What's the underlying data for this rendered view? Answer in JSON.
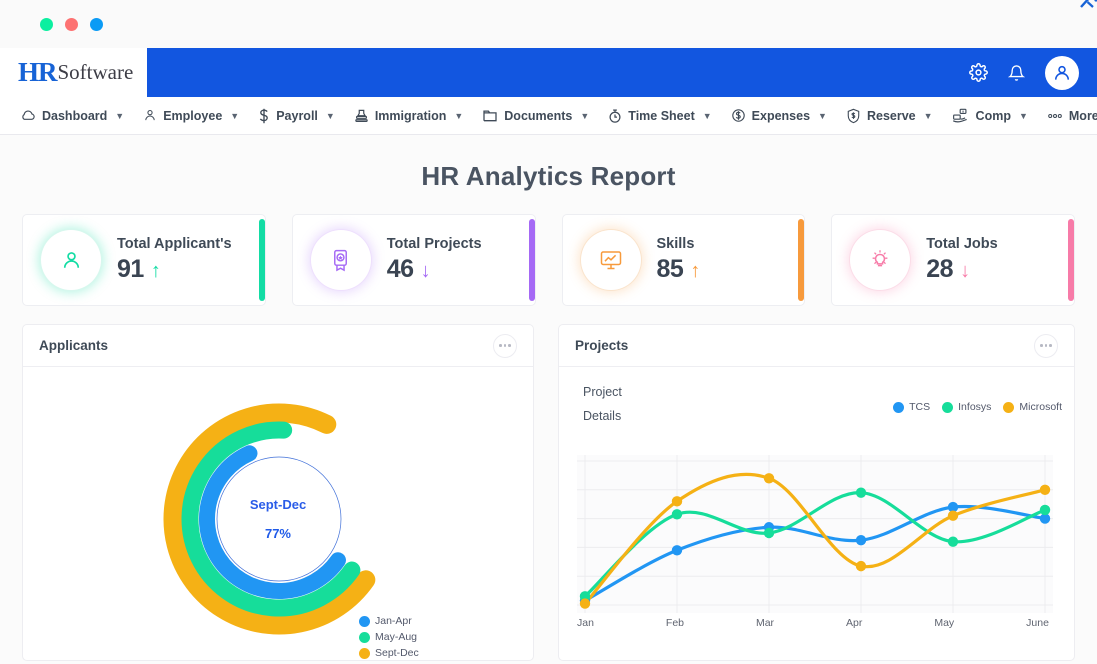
{
  "window": {
    "dots": [
      "green",
      "red",
      "blue"
    ]
  },
  "brand": {
    "hr": "HR",
    "software": "Software"
  },
  "header": {
    "icons": [
      "gear-icon",
      "bell-icon",
      "avatar"
    ]
  },
  "nav": {
    "items": [
      {
        "label": "Dashboard",
        "icon": "cloud-icon",
        "caret": true
      },
      {
        "label": "Employee",
        "icon": "user-icon",
        "caret": true
      },
      {
        "label": "Payroll",
        "icon": "dollar-icon",
        "caret": true
      },
      {
        "label": "Immigration",
        "icon": "stamp-icon",
        "caret": true
      },
      {
        "label": "Documents",
        "icon": "folder-icon",
        "caret": true
      },
      {
        "label": "Time Sheet",
        "icon": "clock-icon",
        "caret": true
      },
      {
        "label": "Expenses",
        "icon": "dollar-circle-icon",
        "caret": true
      },
      {
        "label": "Reserve",
        "icon": "shield-dollar-icon",
        "caret": true
      },
      {
        "label": "Comp",
        "icon": "cash-hand-icon",
        "caret": true
      },
      {
        "label": "More",
        "icon": "ellipsis-icon",
        "caret": false
      }
    ]
  },
  "page": {
    "title": "HR Analytics Report"
  },
  "stats": [
    {
      "label": "Total Applicant's",
      "value": "91",
      "trend": "up",
      "arrow": "↑",
      "color": "#13dca4",
      "icon": "person-icon"
    },
    {
      "label": "Total Projects",
      "value": "46",
      "trend": "down",
      "arrow": "↓",
      "color": "#a569f5",
      "icon": "award-badge-icon"
    },
    {
      "label": "Skills",
      "value": "85",
      "trend": "up",
      "arrow": "↑",
      "color": "#f79a3c",
      "icon": "monitor-chart-icon"
    },
    {
      "label": "Total Jobs",
      "value": "28",
      "trend": "down",
      "arrow": "↓",
      "color": "#f77ba8",
      "icon": "lightbulb-icon"
    }
  ],
  "applicants_panel": {
    "title": "Applicants",
    "menu_icon": "kebab-menu-icon"
  },
  "projects_panel": {
    "title": "Projects",
    "menu_icon": "kebab-menu-icon",
    "heading_line1": "Project",
    "heading_line2": "Details"
  },
  "chart_data": [
    {
      "type": "pie",
      "variant": "radial-multi-ring-gauge",
      "title": "Applicants",
      "center_label": "Sept-Dec",
      "center_value": "77%",
      "legend_position": "bottom-right",
      "categories": [
        "Jan-Apr",
        "May-Aug",
        "Sept-Dec"
      ],
      "values": [
        62,
        70,
        77
      ],
      "colors": [
        "#2196f3",
        "#16dd9a",
        "#f5b115"
      ],
      "series": [
        {
          "name": "Jan-Apr",
          "value": 62,
          "ring": "inner",
          "color": "#2196f3"
        },
        {
          "name": "May-Aug",
          "value": 70,
          "ring": "middle",
          "color": "#16dd9a"
        },
        {
          "name": "Sept-Dec",
          "value": 77,
          "ring": "outer",
          "color": "#f5b115"
        }
      ]
    },
    {
      "type": "line",
      "title": "Project Details",
      "xlabel": "",
      "ylabel": "",
      "grid": true,
      "legend_position": "top-right",
      "categories": [
        "Jan",
        "Feb",
        "Mar",
        "Apr",
        "May",
        "June"
      ],
      "ylim": [
        0,
        100
      ],
      "series": [
        {
          "name": "TCS",
          "color": "#2196f3",
          "values": [
            3,
            38,
            54,
            45,
            68,
            60
          ]
        },
        {
          "name": "Infosys",
          "color": "#16dd9a",
          "values": [
            6,
            63,
            50,
            78,
            44,
            66
          ]
        },
        {
          "name": "Microsoft",
          "color": "#f5b115",
          "values": [
            1,
            72,
            88,
            27,
            62,
            80
          ]
        }
      ]
    }
  ]
}
